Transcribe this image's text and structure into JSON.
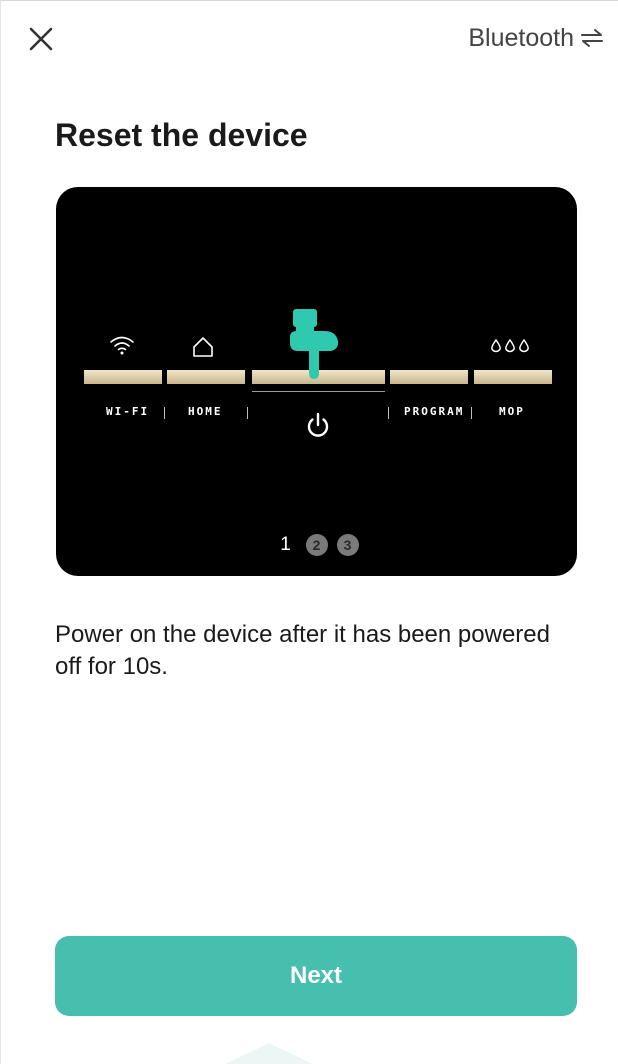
{
  "header": {
    "close_icon": "close-icon",
    "mode_label": "Bluetooth",
    "mode_icon": "switch-arrows-icon"
  },
  "page": {
    "title": "Reset the device"
  },
  "illustration": {
    "buttons": [
      {
        "label": "WI-FI",
        "icon": "wifi-icon"
      },
      {
        "label": "HOME",
        "icon": "home-icon"
      },
      {
        "label": "",
        "icon": "power-icon",
        "pressed": true
      },
      {
        "label": "PROGRAM",
        "icon": ""
      },
      {
        "label": "MOP",
        "icon": "water-drops-icon"
      }
    ],
    "pointer_icon": "pointing-hand-icon",
    "steps": [
      "1",
      "2",
      "3"
    ],
    "active_step": "1"
  },
  "instruction": "Power on the device after it has been powered off for 10s.",
  "footer": {
    "next_label": "Next"
  },
  "colors": {
    "accent": "#46bfaf",
    "panel": "#000000",
    "bar": "#dccfae"
  }
}
